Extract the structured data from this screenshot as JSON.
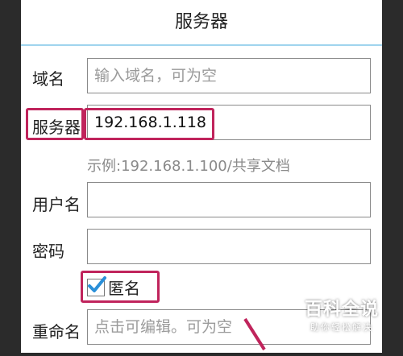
{
  "dialog": {
    "title": "服务器",
    "domain": {
      "label": "域名",
      "value": "",
      "placeholder": "输入域名，可为空"
    },
    "server": {
      "label": "服务器",
      "value": "192.168.1.118"
    },
    "server_hint": "示例:192.168.1.100/共享文档",
    "username": {
      "label": "用户名",
      "value": ""
    },
    "password": {
      "label": "密码",
      "value": ""
    },
    "anonymous": {
      "label": "匿名",
      "checked": true
    },
    "rename": {
      "label": "重命名",
      "value": "",
      "placeholder": "点击可编辑。可为空"
    }
  },
  "watermark": {
    "main": "百科全说",
    "sub": "助你轻松解决"
  },
  "colors": {
    "highlight": "#c0245c",
    "title_underline": "#9fd4ee",
    "check": "#2a8fd8"
  },
  "icons": {
    "checkbox_mark": "checkmark-icon",
    "arrow": "arrow-icon"
  }
}
